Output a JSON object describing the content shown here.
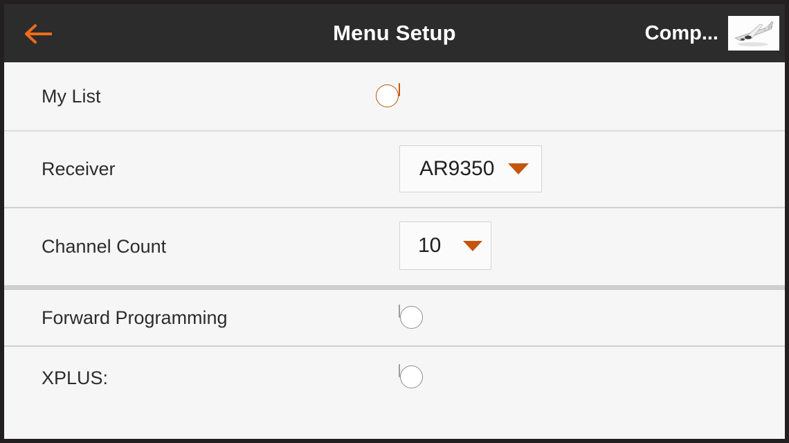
{
  "header": {
    "back_icon": "back-arrow-icon",
    "title": "Menu Setup",
    "model_name": "Comp...",
    "model_thumb_icon": "airplane-thumbnail",
    "background_color": "#2c2c2c",
    "accent_color": "#ee6c1a"
  },
  "settings": {
    "rows": [
      {
        "label": "My List",
        "control": "toggle",
        "value": "on"
      },
      {
        "label": "Receiver",
        "control": "dropdown",
        "value": "AR9350",
        "caret_icon": "chevron-down-icon"
      },
      {
        "label": "Channel Count",
        "control": "dropdown",
        "value": "10",
        "caret_icon": "chevron-down-icon"
      },
      {
        "label": "Forward Programming",
        "control": "toggle",
        "value": "off"
      },
      {
        "label": "XPLUS:",
        "control": "toggle",
        "value": "off"
      }
    ]
  },
  "theme": {
    "body_background": "#f6f6f6",
    "separator_color": "#cfcfcf",
    "toggle_on_color": "#ee6c1a",
    "toggle_off_color": "#c9c9c9",
    "caret_color": "#c4550d",
    "label_color": "#2c2c2c"
  }
}
